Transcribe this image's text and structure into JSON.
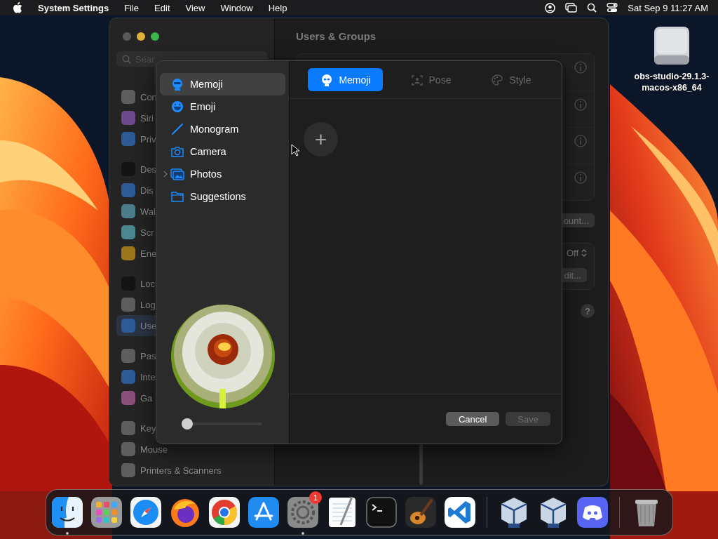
{
  "menu_bar": {
    "app_name": "System Settings",
    "menus": [
      "File",
      "Edit",
      "View",
      "Window",
      "Help"
    ],
    "clock": "Sat Sep 9 11:27 AM"
  },
  "desktop_icon": {
    "label": "obs-studio-29.1.3-macos-x86_64"
  },
  "settings_window": {
    "search": {
      "placeholder": "Sear"
    },
    "sidebar": {
      "groups": [
        {
          "items": [
            {
              "label": "Con",
              "selected": false,
              "color": "#5e5e5e"
            },
            {
              "label": "Siri",
              "selected": false,
              "color": "#6b4a8c"
            },
            {
              "label": "Priv",
              "selected": false,
              "color": "#2e5a96"
            }
          ]
        },
        {
          "items": [
            {
              "label": "Des",
              "selected": false,
              "color": "#141414"
            },
            {
              "label": "Dis",
              "selected": false,
              "color": "#2e5a96"
            },
            {
              "label": "Wal",
              "selected": false,
              "color": "#4d7c8c"
            },
            {
              "label": "Scr",
              "selected": false,
              "color": "#4b8790"
            },
            {
              "label": "Ene",
              "selected": false,
              "color": "#9c761c"
            }
          ]
        },
        {
          "items": [
            {
              "label": "Loc",
              "selected": false,
              "color": "#141414"
            },
            {
              "label": "Log",
              "selected": false,
              "color": "#5e5e5e"
            },
            {
              "label": "Use",
              "selected": true,
              "color": "#2e5a96"
            }
          ]
        },
        {
          "items": [
            {
              "label": "Pas",
              "selected": false,
              "color": "#5e5e5e"
            },
            {
              "label": "Inte",
              "selected": false,
              "color": "#2e5a96"
            },
            {
              "label": "Ga",
              "selected": false,
              "color": "#8a4f78"
            }
          ]
        },
        {
          "items": [
            {
              "label": "Key",
              "selected": false,
              "color": "#5e5e5e"
            },
            {
              "label": "Mouse",
              "selected": false,
              "color": "#5e5e5e"
            },
            {
              "label": "Printers & Scanners",
              "selected": false,
              "color": "#5e5e5e"
            }
          ]
        }
      ]
    },
    "title": "Users & Groups",
    "rows": [
      {
        "kind": "info"
      },
      {
        "kind": "info"
      },
      {
        "kind": "info"
      },
      {
        "kind": "info"
      }
    ],
    "account_button": "ount...",
    "popup": {
      "value": "Off"
    },
    "edit_button": "dit...",
    "help_button": "?"
  },
  "sheet": {
    "sources": [
      {
        "label": "Memoji",
        "selected": true
      },
      {
        "label": "Emoji",
        "selected": false
      },
      {
        "label": "Monogram",
        "selected": false
      },
      {
        "label": "Camera",
        "selected": false
      },
      {
        "label": "Photos",
        "selected": false,
        "expanded": false
      },
      {
        "label": "Suggestions",
        "selected": false
      }
    ],
    "zoom_slider": {
      "level": 0.0
    },
    "tabs": [
      {
        "label": "Memoji",
        "selected": true
      },
      {
        "label": "Pose",
        "selected": false
      },
      {
        "label": "Style",
        "selected": false
      }
    ],
    "add_button": "+",
    "buttons": [
      {
        "label": "Cancel",
        "disabled": false
      },
      {
        "label": "Save",
        "disabled": true
      }
    ]
  },
  "dock": {
    "items": [
      {
        "kind": "app",
        "running": true
      },
      {
        "kind": "app",
        "running": false
      },
      {
        "kind": "app",
        "running": false
      },
      {
        "kind": "app",
        "running": false
      },
      {
        "kind": "app",
        "running": false
      },
      {
        "kind": "app",
        "running": false
      },
      {
        "kind": "app",
        "running": true,
        "badge": "1"
      },
      {
        "kind": "app",
        "running": false
      },
      {
        "kind": "app",
        "running": false
      },
      {
        "kind": "app",
        "running": false
      },
      {
        "kind": "app",
        "running": false
      },
      {
        "kind": "separator"
      },
      {
        "kind": "app",
        "running": false
      },
      {
        "kind": "app",
        "running": false
      },
      {
        "kind": "app",
        "running": false
      },
      {
        "kind": "separator"
      },
      {
        "kind": "app",
        "running": false
      }
    ]
  }
}
